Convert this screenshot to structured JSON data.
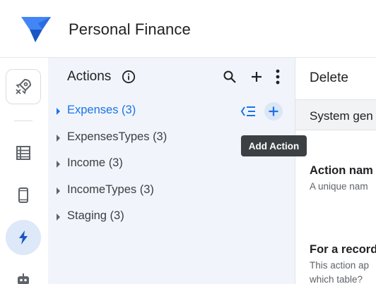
{
  "app": {
    "title": "Personal Finance",
    "logo_icon": "appsheet-logo-icon",
    "brand_color": "#2f80ed"
  },
  "rail": {
    "items": [
      {
        "name": "rocket-icon",
        "active": false
      },
      {
        "name": "table-icon",
        "active": false
      },
      {
        "name": "mobile-icon",
        "active": false
      },
      {
        "name": "lightning-icon",
        "active": true
      },
      {
        "name": "robot-icon",
        "active": false
      }
    ]
  },
  "panel": {
    "title": "Actions",
    "info_icon": "info-icon",
    "header_actions": [
      "search-icon",
      "add-icon",
      "more-vert-icon"
    ],
    "items": [
      {
        "label": "Expenses (3)",
        "active": true
      },
      {
        "label": "ExpensesTypes (3)",
        "active": false
      },
      {
        "label": "Income (3)",
        "active": false
      },
      {
        "label": "IncomeTypes (3)",
        "active": false
      },
      {
        "label": "Staging (3)",
        "active": false
      }
    ],
    "active_color": "#1a73e8"
  },
  "tooltip": {
    "text": "Add Action"
  },
  "detail": {
    "title": "Delete",
    "system_banner": "System gen",
    "field1_label": "Action nam",
    "field1_help": "A unique nam",
    "field2_label": "For a record",
    "field2_help_line1": "This action ap",
    "field2_help_line2": "which table?"
  }
}
